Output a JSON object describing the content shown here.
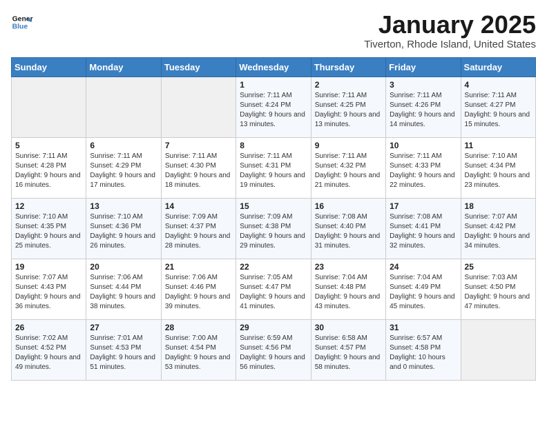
{
  "header": {
    "logo_line1": "General",
    "logo_line2": "Blue",
    "title": "January 2025",
    "subtitle": "Tiverton, Rhode Island, United States"
  },
  "days_of_week": [
    "Sunday",
    "Monday",
    "Tuesday",
    "Wednesday",
    "Thursday",
    "Friday",
    "Saturday"
  ],
  "weeks": [
    [
      {
        "day": "",
        "info": ""
      },
      {
        "day": "",
        "info": ""
      },
      {
        "day": "",
        "info": ""
      },
      {
        "day": "1",
        "info": "Sunrise: 7:11 AM\nSunset: 4:24 PM\nDaylight: 9 hours and 13 minutes."
      },
      {
        "day": "2",
        "info": "Sunrise: 7:11 AM\nSunset: 4:25 PM\nDaylight: 9 hours and 13 minutes."
      },
      {
        "day": "3",
        "info": "Sunrise: 7:11 AM\nSunset: 4:26 PM\nDaylight: 9 hours and 14 minutes."
      },
      {
        "day": "4",
        "info": "Sunrise: 7:11 AM\nSunset: 4:27 PM\nDaylight: 9 hours and 15 minutes."
      }
    ],
    [
      {
        "day": "5",
        "info": "Sunrise: 7:11 AM\nSunset: 4:28 PM\nDaylight: 9 hours and 16 minutes."
      },
      {
        "day": "6",
        "info": "Sunrise: 7:11 AM\nSunset: 4:29 PM\nDaylight: 9 hours and 17 minutes."
      },
      {
        "day": "7",
        "info": "Sunrise: 7:11 AM\nSunset: 4:30 PM\nDaylight: 9 hours and 18 minutes."
      },
      {
        "day": "8",
        "info": "Sunrise: 7:11 AM\nSunset: 4:31 PM\nDaylight: 9 hours and 19 minutes."
      },
      {
        "day": "9",
        "info": "Sunrise: 7:11 AM\nSunset: 4:32 PM\nDaylight: 9 hours and 21 minutes."
      },
      {
        "day": "10",
        "info": "Sunrise: 7:11 AM\nSunset: 4:33 PM\nDaylight: 9 hours and 22 minutes."
      },
      {
        "day": "11",
        "info": "Sunrise: 7:10 AM\nSunset: 4:34 PM\nDaylight: 9 hours and 23 minutes."
      }
    ],
    [
      {
        "day": "12",
        "info": "Sunrise: 7:10 AM\nSunset: 4:35 PM\nDaylight: 9 hours and 25 minutes."
      },
      {
        "day": "13",
        "info": "Sunrise: 7:10 AM\nSunset: 4:36 PM\nDaylight: 9 hours and 26 minutes."
      },
      {
        "day": "14",
        "info": "Sunrise: 7:09 AM\nSunset: 4:37 PM\nDaylight: 9 hours and 28 minutes."
      },
      {
        "day": "15",
        "info": "Sunrise: 7:09 AM\nSunset: 4:38 PM\nDaylight: 9 hours and 29 minutes."
      },
      {
        "day": "16",
        "info": "Sunrise: 7:08 AM\nSunset: 4:40 PM\nDaylight: 9 hours and 31 minutes."
      },
      {
        "day": "17",
        "info": "Sunrise: 7:08 AM\nSunset: 4:41 PM\nDaylight: 9 hours and 32 minutes."
      },
      {
        "day": "18",
        "info": "Sunrise: 7:07 AM\nSunset: 4:42 PM\nDaylight: 9 hours and 34 minutes."
      }
    ],
    [
      {
        "day": "19",
        "info": "Sunrise: 7:07 AM\nSunset: 4:43 PM\nDaylight: 9 hours and 36 minutes."
      },
      {
        "day": "20",
        "info": "Sunrise: 7:06 AM\nSunset: 4:44 PM\nDaylight: 9 hours and 38 minutes."
      },
      {
        "day": "21",
        "info": "Sunrise: 7:06 AM\nSunset: 4:46 PM\nDaylight: 9 hours and 39 minutes."
      },
      {
        "day": "22",
        "info": "Sunrise: 7:05 AM\nSunset: 4:47 PM\nDaylight: 9 hours and 41 minutes."
      },
      {
        "day": "23",
        "info": "Sunrise: 7:04 AM\nSunset: 4:48 PM\nDaylight: 9 hours and 43 minutes."
      },
      {
        "day": "24",
        "info": "Sunrise: 7:04 AM\nSunset: 4:49 PM\nDaylight: 9 hours and 45 minutes."
      },
      {
        "day": "25",
        "info": "Sunrise: 7:03 AM\nSunset: 4:50 PM\nDaylight: 9 hours and 47 minutes."
      }
    ],
    [
      {
        "day": "26",
        "info": "Sunrise: 7:02 AM\nSunset: 4:52 PM\nDaylight: 9 hours and 49 minutes."
      },
      {
        "day": "27",
        "info": "Sunrise: 7:01 AM\nSunset: 4:53 PM\nDaylight: 9 hours and 51 minutes."
      },
      {
        "day": "28",
        "info": "Sunrise: 7:00 AM\nSunset: 4:54 PM\nDaylight: 9 hours and 53 minutes."
      },
      {
        "day": "29",
        "info": "Sunrise: 6:59 AM\nSunset: 4:56 PM\nDaylight: 9 hours and 56 minutes."
      },
      {
        "day": "30",
        "info": "Sunrise: 6:58 AM\nSunset: 4:57 PM\nDaylight: 9 hours and 58 minutes."
      },
      {
        "day": "31",
        "info": "Sunrise: 6:57 AM\nSunset: 4:58 PM\nDaylight: 10 hours and 0 minutes."
      },
      {
        "day": "",
        "info": ""
      }
    ]
  ]
}
